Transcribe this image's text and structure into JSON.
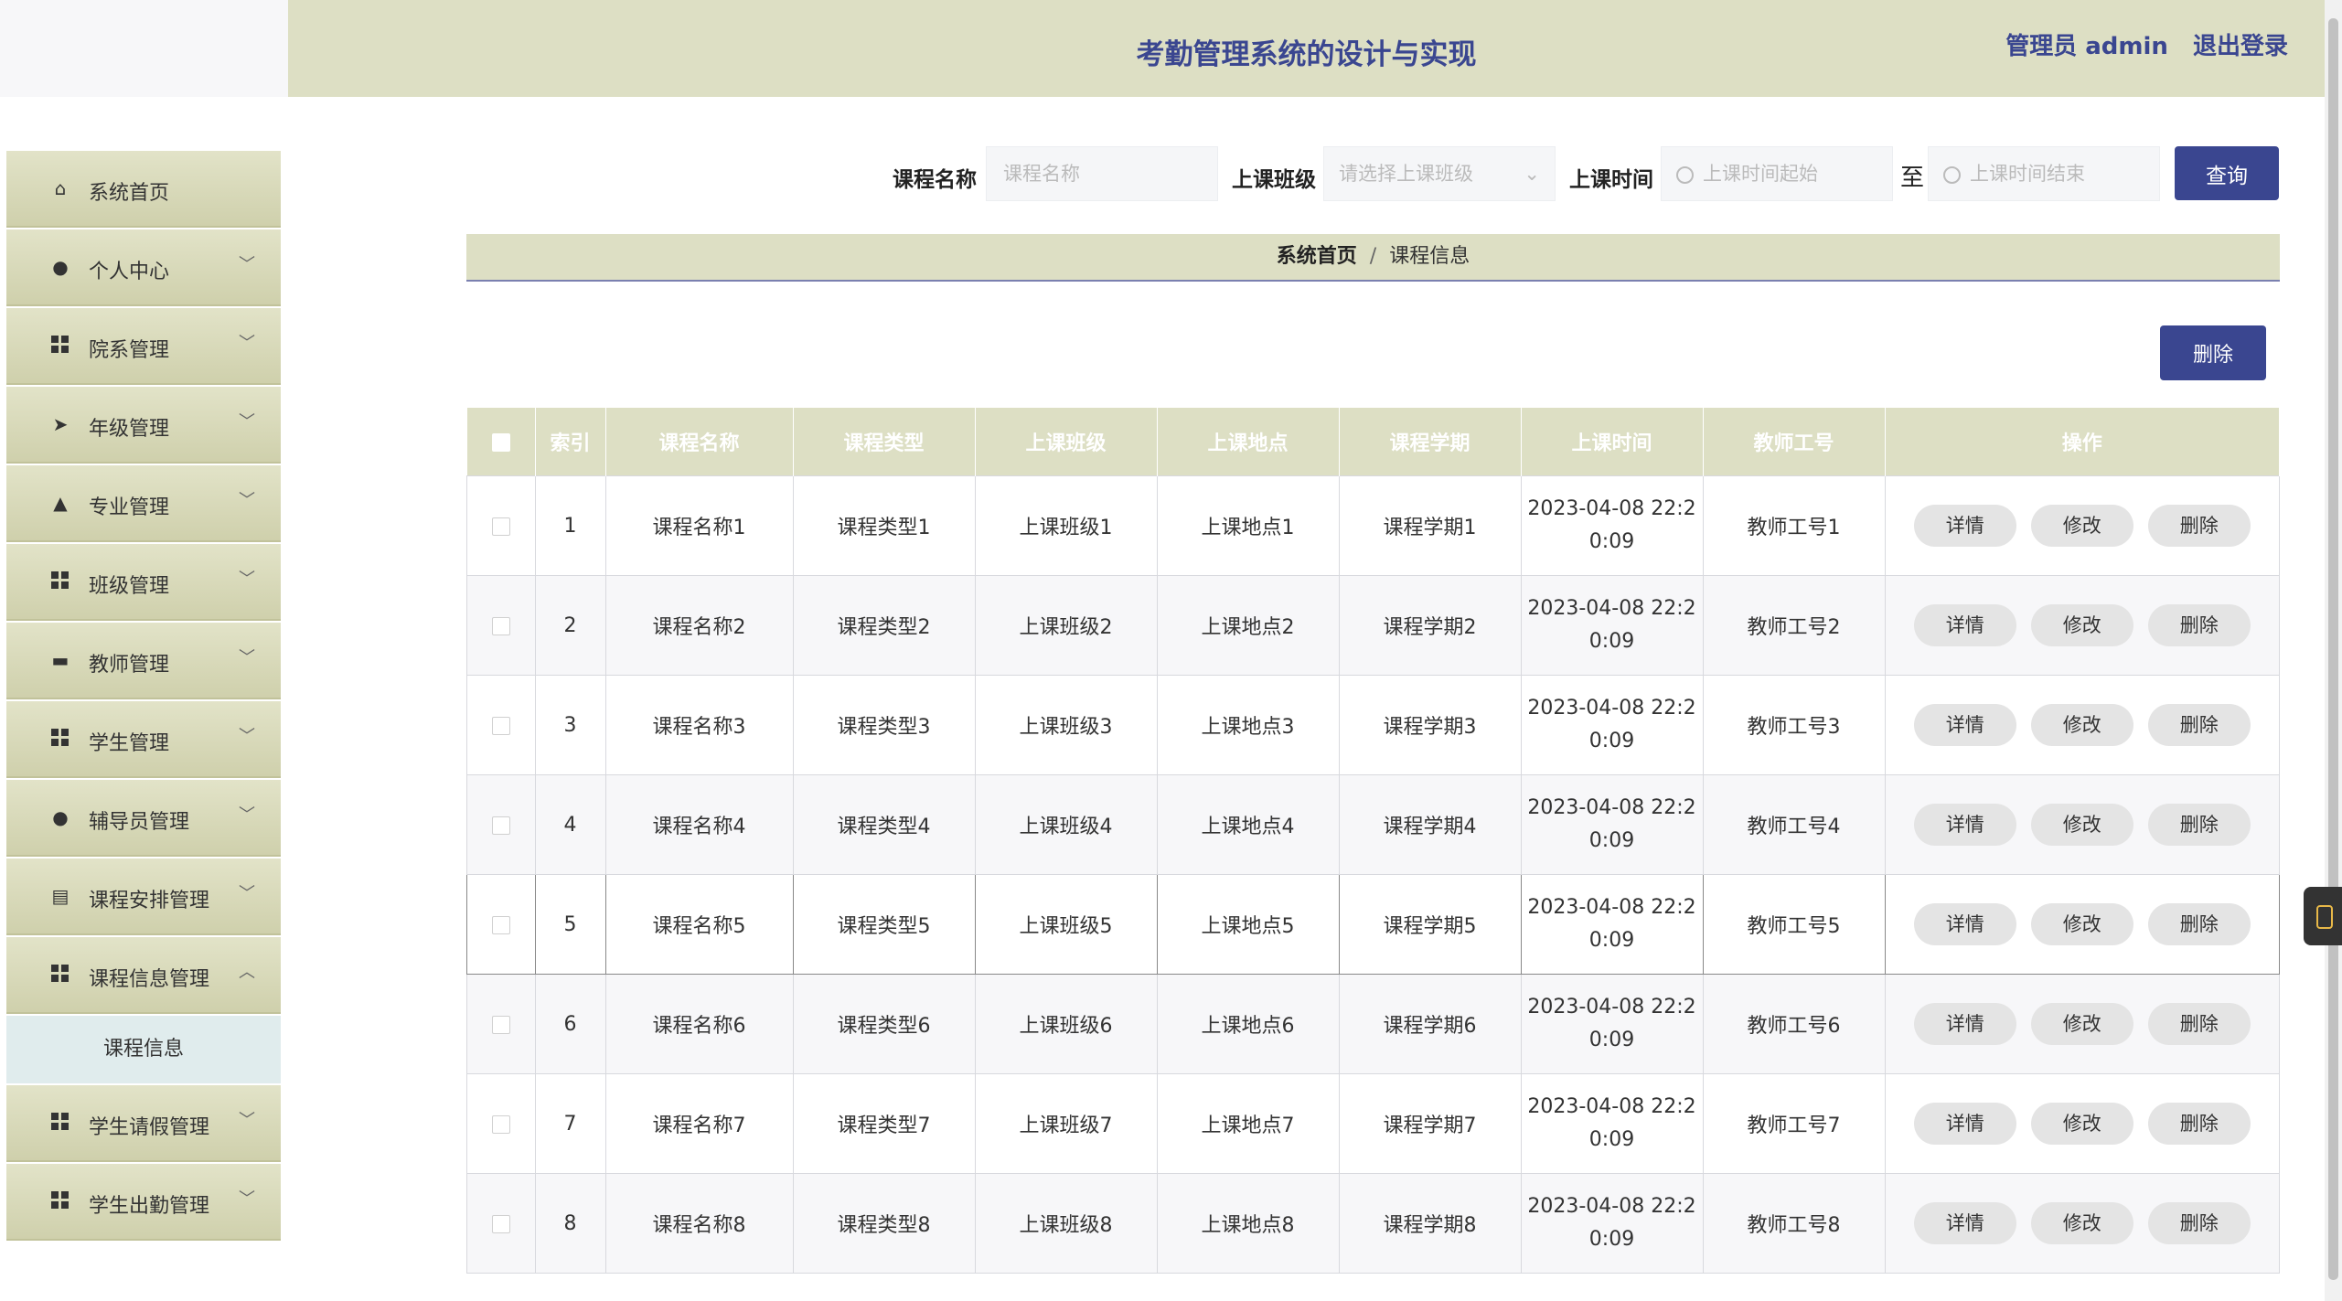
{
  "header": {
    "title": "考勤管理系统的设计与实现",
    "user_label": "管理员 admin",
    "logout_label": "退出登录"
  },
  "sidebar": {
    "items": [
      {
        "label": "系统首页",
        "icon": "home-icon",
        "expandable": false
      },
      {
        "label": "个人中心",
        "icon": "user-icon",
        "expandable": true
      },
      {
        "label": "院系管理",
        "icon": "grid-icon",
        "expandable": true
      },
      {
        "label": "年级管理",
        "icon": "send-icon",
        "expandable": true
      },
      {
        "label": "专业管理",
        "icon": "user-badge-icon",
        "expandable": true
      },
      {
        "label": "班级管理",
        "icon": "grid-icon",
        "expandable": true
      },
      {
        "label": "教师管理",
        "icon": "briefcase-icon",
        "expandable": true
      },
      {
        "label": "学生管理",
        "icon": "grid-icon",
        "expandable": true
      },
      {
        "label": "辅导员管理",
        "icon": "bulb-icon",
        "expandable": true
      },
      {
        "label": "课程安排管理",
        "icon": "clipboard-icon",
        "expandable": true
      },
      {
        "label": "课程信息管理",
        "icon": "grid-icon",
        "expandable": true,
        "expanded": true
      },
      {
        "label": "学生请假管理",
        "icon": "grid-icon",
        "expandable": true
      },
      {
        "label": "学生出勤管理",
        "icon": "grid-icon",
        "expandable": true
      }
    ],
    "submenu": {
      "label": "课程信息"
    }
  },
  "search": {
    "course_name_label": "课程名称",
    "course_name_placeholder": "课程名称",
    "class_label": "上课班级",
    "class_placeholder": "请选择上课班级",
    "time_label": "上课时间",
    "time_start_placeholder": "上课时间起始",
    "time_to": "至",
    "time_end_placeholder": "上课时间结束",
    "query_button": "查询"
  },
  "breadcrumb": {
    "home": "系统首页",
    "sep": "/",
    "current": "课程信息"
  },
  "toolbar": {
    "delete_label": "删除"
  },
  "table": {
    "headers": [
      "索引",
      "课程名称",
      "课程类型",
      "上课班级",
      "上课地点",
      "课程学期",
      "上课时间",
      "教师工号",
      "操作"
    ],
    "actions": {
      "detail": "详情",
      "edit": "修改",
      "delete": "删除"
    },
    "rows": [
      {
        "index": "1",
        "name": "课程名称1",
        "type": "课程类型1",
        "class": "上课班级1",
        "place": "上课地点1",
        "term": "课程学期1",
        "time1": "2023-04-08 22:2",
        "time2": "0:09",
        "teacher": "教师工号1"
      },
      {
        "index": "2",
        "name": "课程名称2",
        "type": "课程类型2",
        "class": "上课班级2",
        "place": "上课地点2",
        "term": "课程学期2",
        "time1": "2023-04-08 22:2",
        "time2": "0:09",
        "teacher": "教师工号2"
      },
      {
        "index": "3",
        "name": "课程名称3",
        "type": "课程类型3",
        "class": "上课班级3",
        "place": "上课地点3",
        "term": "课程学期3",
        "time1": "2023-04-08 22:2",
        "time2": "0:09",
        "teacher": "教师工号3"
      },
      {
        "index": "4",
        "name": "课程名称4",
        "type": "课程类型4",
        "class": "上课班级4",
        "place": "上课地点4",
        "term": "课程学期4",
        "time1": "2023-04-08 22:2",
        "time2": "0:09",
        "teacher": "教师工号4"
      },
      {
        "index": "5",
        "name": "课程名称5",
        "type": "课程类型5",
        "class": "上课班级5",
        "place": "上课地点5",
        "term": "课程学期5",
        "time1": "2023-04-08 22:2",
        "time2": "0:09",
        "teacher": "教师工号5"
      },
      {
        "index": "6",
        "name": "课程名称6",
        "type": "课程类型6",
        "class": "上课班级6",
        "place": "上课地点6",
        "term": "课程学期6",
        "time1": "2023-04-08 22:2",
        "time2": "0:09",
        "teacher": "教师工号6"
      },
      {
        "index": "7",
        "name": "课程名称7",
        "type": "课程类型7",
        "class": "上课班级7",
        "place": "上课地点7",
        "term": "课程学期7",
        "time1": "2023-04-08 22:2",
        "time2": "0:09",
        "teacher": "教师工号7"
      },
      {
        "index": "8",
        "name": "课程名称8",
        "type": "课程类型8",
        "class": "上课班级8",
        "place": "上课地点8",
        "term": "课程学期8",
        "time1": "2023-04-08 22:2",
        "time2": "0:09",
        "teacher": "教师工号8"
      }
    ]
  },
  "colors": {
    "primary": "#3a4690",
    "header_bg": "#dddfc4",
    "sidebar_bg": "#d6d7b8",
    "submenu_bg": "#e0eced"
  }
}
